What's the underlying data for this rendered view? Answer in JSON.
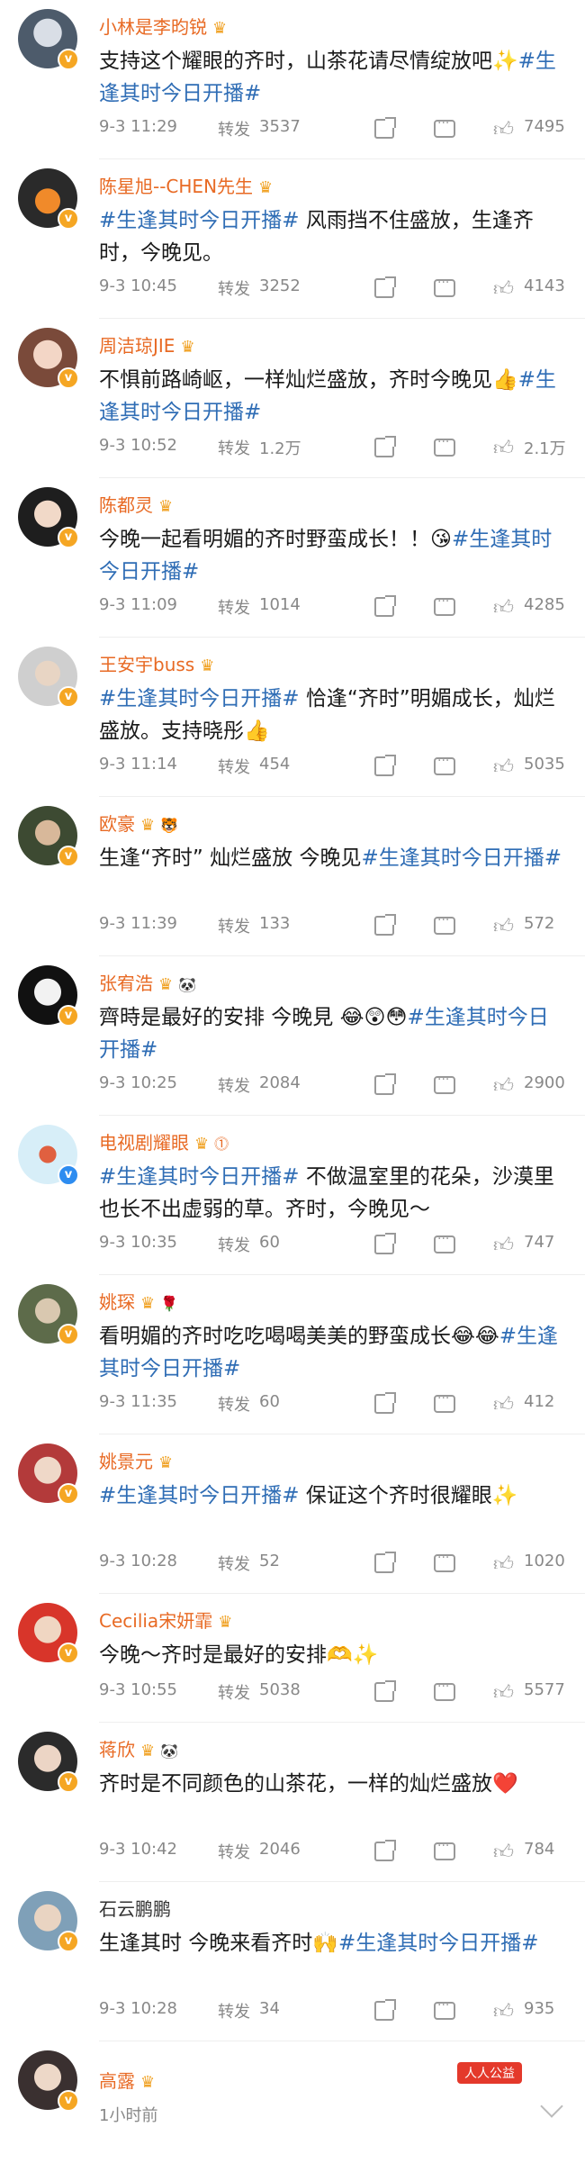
{
  "posts": [
    {
      "name": "小林是李昀锐",
      "crown": true,
      "extra": "",
      "text": "支持这个耀眼的齐时，山茶花请尽情绽放吧✨",
      "tag": "#生逢其时今日开播#",
      "time": "9-3 11:29",
      "reposts": "3537",
      "likes": "7495"
    },
    {
      "name": "陈星旭--CHEN先生",
      "crown": true,
      "extra": "",
      "text": "风雨挡不住盛放，生逢齐时，今晚见。",
      "tag_first": "#生逢其时今日开播#",
      "time": "9-3 10:45",
      "reposts": "3252",
      "likes": "4143"
    },
    {
      "name": "周洁琼JIE",
      "crown": true,
      "extra": "",
      "text": "不惧前路崎岖，一样灿烂盛放，齐时今晚见👍",
      "tag": "#生逢其时今日开播#",
      "time": "9-3 10:52",
      "reposts": "1.2万",
      "likes": "2.1万"
    },
    {
      "name": "陈都灵",
      "crown": true,
      "extra": "",
      "text": "今晚一起看明媚的齐时野蛮成长！！😘",
      "tag": "#生逢其时今日开播#",
      "time": "9-3 11:09",
      "reposts": "1014",
      "likes": "4285"
    },
    {
      "name": "王安宇buss",
      "crown": true,
      "extra": "",
      "text": "恰逢“齐时”明媚成长，灿烂盛放。支持晓彤👍",
      "tag_first": "#生逢其时今日开播#",
      "time": "9-3 11:14",
      "reposts": "454",
      "likes": "5035"
    },
    {
      "name": "欧豪",
      "crown": true,
      "extra": "🐯",
      "text": "生逢“齐时” 灿烂盛放 今晚见",
      "tag": "#生逢其时今日开播#",
      "time": "9-3 11:39",
      "reposts": "133",
      "likes": "572"
    },
    {
      "name": "张宥浩",
      "crown": true,
      "extra": "🐼",
      "text": "齊時是最好的安排 今晚見 😂😲😳",
      "tag": "#生逢其时今日开播#",
      "time": "9-3 10:25",
      "reposts": "2084",
      "likes": "2900"
    },
    {
      "name": "电视剧耀眼",
      "crown": true,
      "extra": "⓵",
      "text": "不做温室里的花朵，沙漠里也长不出虚弱的草。齐时，今晚见～",
      "tag_first": "#生逢其时今日开播#",
      "time": "9-3 10:35",
      "reposts": "60",
      "likes": "747"
    },
    {
      "name": "姚琛",
      "crown": true,
      "extra": "🌹",
      "text": "看明媚的齐时吃吃喝喝美美的野蛮成长😂😂",
      "tag": "#生逢其时今日开播#",
      "time": "9-3 11:35",
      "reposts": "60",
      "likes": "412"
    },
    {
      "name": "姚景元",
      "crown": true,
      "extra": "",
      "text": "保证这个齐时很耀眼✨",
      "tag_first": "#生逢其时今日开播#",
      "time": "9-3 10:28",
      "reposts": "52",
      "likes": "1020"
    },
    {
      "name": "Cecilia宋妍霏",
      "crown": true,
      "extra": "",
      "text": "今晚～齐时是最好的安排🫶✨",
      "tag": "",
      "time": "9-3 10:55",
      "reposts": "5038",
      "likes": "5577"
    },
    {
      "name": "蒋欣",
      "crown": true,
      "extra": "🐼",
      "text": "齐时是不同颜色的山茶花，一样的灿烂盛放❤️",
      "tag": "",
      "time": "9-3 10:42",
      "reposts": "2046",
      "likes": "784"
    },
    {
      "name": "石云鹏鹏",
      "crown": false,
      "extra": "",
      "text": "生逢其时 今晚来看齐时🙌",
      "tag": "#生逢其时今日开播#",
      "time": "9-3 10:28",
      "reposts": "34",
      "likes": "935"
    }
  ],
  "last": {
    "name": "高露",
    "time": "1小时前"
  },
  "labels": {
    "repost": "转发"
  },
  "watermark": "人人公益"
}
